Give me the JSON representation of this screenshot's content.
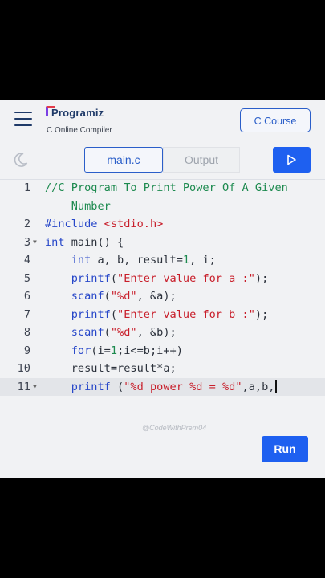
{
  "header": {
    "brand": "Programiz",
    "subtitle": "C Online Compiler",
    "course_button": "C Course"
  },
  "toolbar": {
    "tabs": [
      "main.c",
      "Output"
    ],
    "active_tab": "main.c",
    "icons": {
      "theme": "moon-icon",
      "run": "play-icon"
    }
  },
  "editor": {
    "current_line": 11,
    "lines": [
      {
        "num": "1",
        "fold": "",
        "segments": [
          [
            "c-com",
            "//C Program To Print Power Of A Given"
          ]
        ]
      },
      {
        "num": "",
        "fold": "",
        "segments": [
          [
            "c-com",
            "    Number"
          ]
        ]
      },
      {
        "num": "2",
        "fold": "",
        "segments": [
          [
            "c-pre",
            "#include "
          ],
          [
            "c-inc",
            "<stdio.h>"
          ]
        ]
      },
      {
        "num": "3",
        "fold": "▼",
        "segments": [
          [
            "c-kw",
            "int"
          ],
          [
            "c-op",
            " main() {"
          ]
        ]
      },
      {
        "num": "4",
        "fold": "",
        "segments": [
          [
            "c-op",
            "    "
          ],
          [
            "c-kw",
            "int"
          ],
          [
            "c-op",
            " a, b, result="
          ],
          [
            "c-num",
            "1"
          ],
          [
            "c-op",
            ", i;"
          ]
        ]
      },
      {
        "num": "5",
        "fold": "",
        "segments": [
          [
            "c-op",
            "    "
          ],
          [
            "c-kw",
            "printf"
          ],
          [
            "c-op",
            "("
          ],
          [
            "c-str",
            "\"Enter value for a :\""
          ],
          [
            "c-op",
            ");"
          ]
        ]
      },
      {
        "num": "6",
        "fold": "",
        "segments": [
          [
            "c-op",
            "    "
          ],
          [
            "c-kw",
            "scanf"
          ],
          [
            "c-op",
            "("
          ],
          [
            "c-str",
            "\"%d\""
          ],
          [
            "c-op",
            ", &a);"
          ]
        ]
      },
      {
        "num": "7",
        "fold": "",
        "segments": [
          [
            "c-op",
            "    "
          ],
          [
            "c-kw",
            "printf"
          ],
          [
            "c-op",
            "("
          ],
          [
            "c-str",
            "\"Enter value for b :\""
          ],
          [
            "c-op",
            ");"
          ]
        ]
      },
      {
        "num": "8",
        "fold": "",
        "segments": [
          [
            "c-op",
            "    "
          ],
          [
            "c-kw",
            "scanf"
          ],
          [
            "c-op",
            "("
          ],
          [
            "c-str",
            "\"%d\""
          ],
          [
            "c-op",
            ", &b);"
          ]
        ]
      },
      {
        "num": "9",
        "fold": "",
        "segments": [
          [
            "c-op",
            "    "
          ],
          [
            "c-kw",
            "for"
          ],
          [
            "c-op",
            "(i="
          ],
          [
            "c-num",
            "1"
          ],
          [
            "c-op",
            ";i<=b;i++)"
          ]
        ]
      },
      {
        "num": "10",
        "fold": "",
        "segments": [
          [
            "c-op",
            "    result=result*a;"
          ]
        ]
      },
      {
        "num": "11",
        "fold": "▼",
        "segments": [
          [
            "c-op",
            "    "
          ],
          [
            "c-kw",
            "printf"
          ],
          [
            "c-op",
            " ("
          ],
          [
            "c-str",
            "\"%d power %d = %d\""
          ],
          [
            "c-op",
            ",a,b,"
          ]
        ]
      }
    ]
  },
  "watermark": "@CodeWithPrem04",
  "run_button": "Run",
  "colors": {
    "accent": "#1e60f0",
    "comment": "#1d8a4f",
    "keyword": "#2747c9",
    "string": "#c81e2a",
    "background": "#f1f2f4"
  }
}
